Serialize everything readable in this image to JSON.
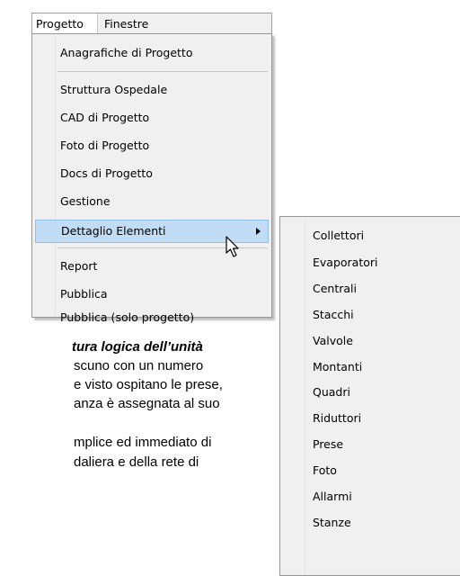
{
  "menubar": {
    "items": [
      "Progetto",
      "Finestre"
    ]
  },
  "menu": {
    "items": [
      "Anagrafiche di Progetto",
      "Struttura Ospedale",
      "CAD di Progetto",
      "Foto di Progetto",
      "Docs di Progetto",
      "Gestione",
      "Dettaglio Elementi",
      "Report",
      "Pubblica",
      "Pubblica (solo progetto)"
    ],
    "highlighted": "Dettaglio Elementi",
    "highlight_color": "#c1ddf6"
  },
  "submenu": {
    "items": [
      "Collettori",
      "Evaporatori",
      "Centrali",
      "Stacchi",
      "Valvole",
      "Montanti",
      "Quadri",
      "Riduttori",
      "Prese",
      "Foto",
      "Allarmi",
      "Stanze"
    ]
  },
  "document": {
    "line1": "tura  logica  dell’unità",
    "line2": "scuno  con  un  numero",
    "line3": "e visto ospitano le prese,",
    "line4": "anza è assegnata al suo",
    "line5": "mplice ed immediato di",
    "line6": "daliera  e  della  rete  di"
  }
}
